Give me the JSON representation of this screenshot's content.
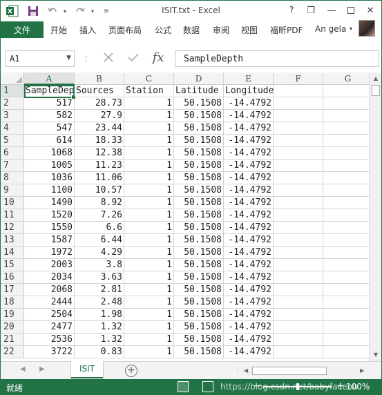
{
  "titlebar": {
    "title": "ISIT.txt - Excel",
    "help": "?",
    "minimize": "—",
    "restore": "❐",
    "close": "✕"
  },
  "ribbon": {
    "file_tab": "文件",
    "tabs": [
      "开始",
      "插入",
      "页面布局",
      "公式",
      "数据",
      "审阅",
      "视图",
      "福昕PDF"
    ],
    "user": "An gela"
  },
  "formula_bar": {
    "name_box": "A1",
    "formula": "SampleDepth"
  },
  "sheet": {
    "columns": [
      "A",
      "B",
      "C",
      "D",
      "E",
      "F",
      "G"
    ],
    "row_numbers": [
      "1",
      "2",
      "3",
      "4",
      "5",
      "6",
      "7",
      "8",
      "9",
      "10",
      "11",
      "12",
      "13",
      "14",
      "15",
      "16",
      "17",
      "18",
      "19",
      "20",
      "21",
      "22"
    ],
    "header_row": [
      "SampleDepth",
      "Sources",
      "Station",
      "Latitude",
      "Longitude"
    ],
    "rows": [
      [
        "517",
        "28.73",
        "1",
        "50.1508",
        "-14.4792"
      ],
      [
        "582",
        "27.9",
        "1",
        "50.1508",
        "-14.4792"
      ],
      [
        "547",
        "23.44",
        "1",
        "50.1508",
        "-14.4792"
      ],
      [
        "614",
        "18.33",
        "1",
        "50.1508",
        "-14.4792"
      ],
      [
        "1068",
        "12.38",
        "1",
        "50.1508",
        "-14.4792"
      ],
      [
        "1005",
        "11.23",
        "1",
        "50.1508",
        "-14.4792"
      ],
      [
        "1036",
        "11.06",
        "1",
        "50.1508",
        "-14.4792"
      ],
      [
        "1100",
        "10.57",
        "1",
        "50.1508",
        "-14.4792"
      ],
      [
        "1490",
        "8.92",
        "1",
        "50.1508",
        "-14.4792"
      ],
      [
        "1520",
        "7.26",
        "1",
        "50.1508",
        "-14.4792"
      ],
      [
        "1550",
        "6.6",
        "1",
        "50.1508",
        "-14.4792"
      ],
      [
        "1587",
        "6.44",
        "1",
        "50.1508",
        "-14.4792"
      ],
      [
        "1972",
        "4.29",
        "1",
        "50.1508",
        "-14.4792"
      ],
      [
        "2003",
        "3.8",
        "1",
        "50.1508",
        "-14.4792"
      ],
      [
        "2034",
        "3.63",
        "1",
        "50.1508",
        "-14.4792"
      ],
      [
        "2068",
        "2.81",
        "1",
        "50.1508",
        "-14.4792"
      ],
      [
        "2444",
        "2.48",
        "1",
        "50.1508",
        "-14.4792"
      ],
      [
        "2504",
        "1.98",
        "1",
        "50.1508",
        "-14.4792"
      ],
      [
        "2477",
        "1.32",
        "1",
        "50.1508",
        "-14.4792"
      ],
      [
        "2536",
        "1.32",
        "1",
        "50.1508",
        "-14.4792"
      ],
      [
        "3722",
        "0.83",
        "1",
        "50.1508",
        "-14.4792"
      ]
    ]
  },
  "sheet_tabs": {
    "active": "ISIT",
    "add": "+"
  },
  "status": {
    "text": "就绪",
    "watermark": "https://blog.csdn.net/babyfaceou",
    "zoom": "100%",
    "zoom_minus": "−",
    "zoom_plus": "+",
    "zoom_level_percent": 100
  }
}
